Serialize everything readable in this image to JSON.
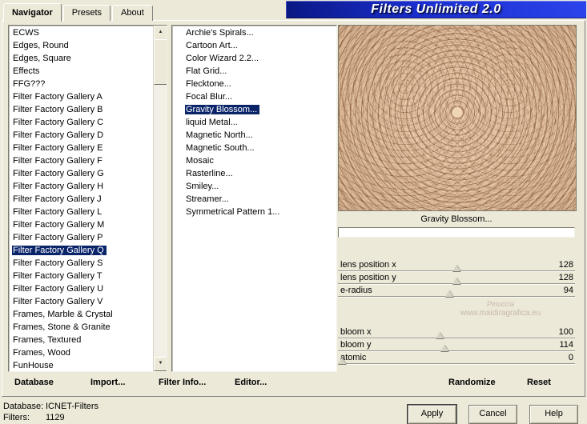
{
  "window": {
    "banner_title": "Filters Unlimited 2.0",
    "tabs": [
      {
        "label": "Navigator",
        "active": true
      },
      {
        "label": "Presets",
        "active": false
      },
      {
        "label": "About",
        "active": false
      }
    ]
  },
  "icons": {
    "scroll_up": "▲",
    "scroll_down": "▼"
  },
  "categories": {
    "selected": "Filter Factory Gallery Q",
    "items": [
      "ECWS",
      "Edges, Round",
      "Edges, Square",
      "Effects",
      "FFG???",
      "Filter Factory Gallery A",
      "Filter Factory Gallery B",
      "Filter Factory Gallery C",
      "Filter Factory Gallery D",
      "Filter Factory Gallery E",
      "Filter Factory Gallery F",
      "Filter Factory Gallery G",
      "Filter Factory Gallery H",
      "Filter Factory Gallery J",
      "Filter Factory Gallery L",
      "Filter Factory Gallery M",
      "Filter Factory Gallery P",
      "Filter Factory Gallery Q",
      "Filter Factory Gallery S",
      "Filter Factory Gallery T",
      "Filter Factory Gallery U",
      "Filter Factory Gallery V",
      "Frames, Marble & Crystal",
      "Frames, Stone & Granite",
      "Frames, Textured",
      "Frames, Wood",
      "FunHouse"
    ]
  },
  "filters": {
    "selected": "Gravity Blossom...",
    "items": [
      "Archie's Spirals...",
      "Cartoon Art...",
      "Color Wizard 2.2...",
      "Flat Grid...",
      "Flecktone...",
      "Focal Blur...",
      "Gravity Blossom...",
      "liquid Metal...",
      "Magnetic North...",
      "Magnetic South...",
      "Mosaic",
      "Rasterline...",
      "Smiley...",
      "Streamer...",
      "Symmetrical Pattern 1..."
    ]
  },
  "preview": {
    "filter_name": "Gravity Blossom...",
    "progress_pct": 0,
    "watermark": [
      "Pinuccia",
      "www.maidiragrafica.eu"
    ]
  },
  "parameters": {
    "group1": [
      {
        "label": "lens position x",
        "value": "128",
        "pct": 50
      },
      {
        "label": "lens position y",
        "value": "128",
        "pct": 50
      },
      {
        "label": "e-radius",
        "value": "94",
        "pct": 47
      }
    ],
    "group2": [
      {
        "label": "bloom x",
        "value": "100",
        "pct": 43
      },
      {
        "label": "bloom y",
        "value": "114",
        "pct": 45
      },
      {
        "label": "atomic",
        "value": "0",
        "pct": 0
      }
    ]
  },
  "toolbar": {
    "database": "Database",
    "import": "Import...",
    "filter_info": "Filter Info...",
    "editor": "Editor...",
    "randomize": "Randomize",
    "reset": "Reset"
  },
  "status": {
    "database_label": "Database:",
    "database_value": "ICNET-Filters",
    "filters_label": "Filters:",
    "filters_value": "1129"
  },
  "dialog_buttons": {
    "apply": "Apply",
    "cancel": "Cancel",
    "help": "Help"
  },
  "colors": {
    "selection": "#0a246a",
    "banner_left": "#0a1884",
    "banner_right": "#2b43ea",
    "preview_base": "#c89872"
  }
}
